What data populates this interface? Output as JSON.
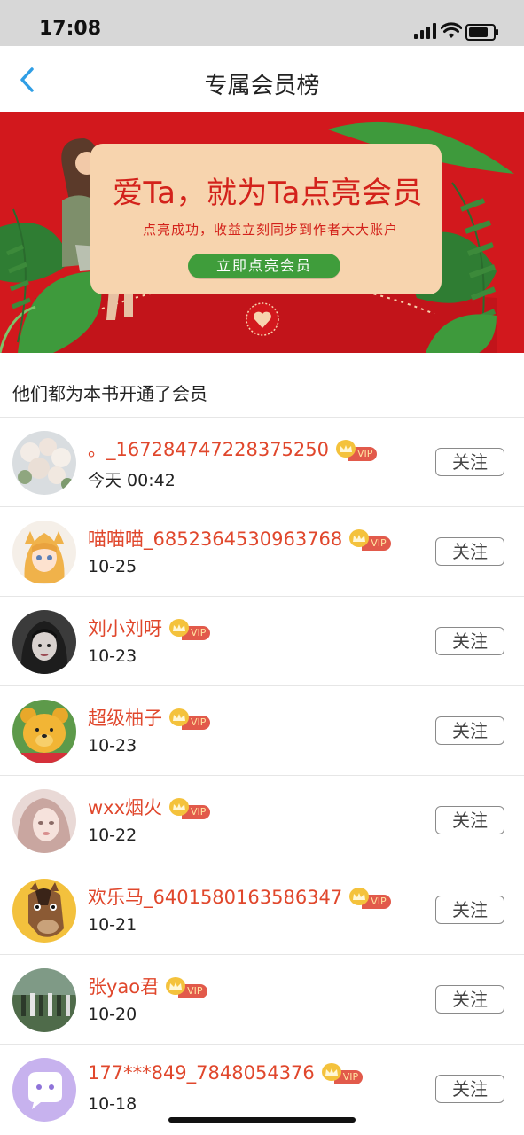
{
  "status_bar": {
    "time": "17:08"
  },
  "header": {
    "title": "专属会员榜"
  },
  "banner": {
    "headline": "爱Ta，就为Ta点亮会员",
    "subtitle": "点亮成功，收益立刻同步到作者大大账户",
    "cta_label": "立即点亮会员"
  },
  "section": {
    "title": "他们都为本书开通了会员"
  },
  "vip_badge": "VIP",
  "members": [
    {
      "name": "。_167284747228375250",
      "date": "今天 00:42",
      "follow_label": "关注",
      "avatar": "flowers-avatar"
    },
    {
      "name": "喵喵喵_6852364530963768",
      "date": "10-25",
      "follow_label": "关注",
      "avatar": "anime-girl-avatar"
    },
    {
      "name": "刘小刘呀",
      "date": "10-23",
      "follow_label": "关注",
      "avatar": "dark-hair-girl-avatar"
    },
    {
      "name": "超级柚子",
      "date": "10-23",
      "follow_label": "关注",
      "avatar": "bear-avatar"
    },
    {
      "name": "wxx烟火",
      "date": "10-22",
      "follow_label": "关注",
      "avatar": "blurred-face-avatar"
    },
    {
      "name": "欢乐马_6401580163586347",
      "date": "10-21",
      "follow_label": "关注",
      "avatar": "horse-avatar"
    },
    {
      "name": "张yao君",
      "date": "10-20",
      "follow_label": "关注",
      "avatar": "group-photo-avatar"
    },
    {
      "name": "177***849_7848054376",
      "date": "10-18",
      "follow_label": "关注",
      "avatar": "chat-bubble-avatar"
    }
  ],
  "colors": {
    "accent_blue": "#2f9ee5",
    "banner_red": "#d2181d",
    "username_red": "#e0472c",
    "cta_green": "#3f9d3b",
    "vip_gold": "#f4c23c"
  }
}
